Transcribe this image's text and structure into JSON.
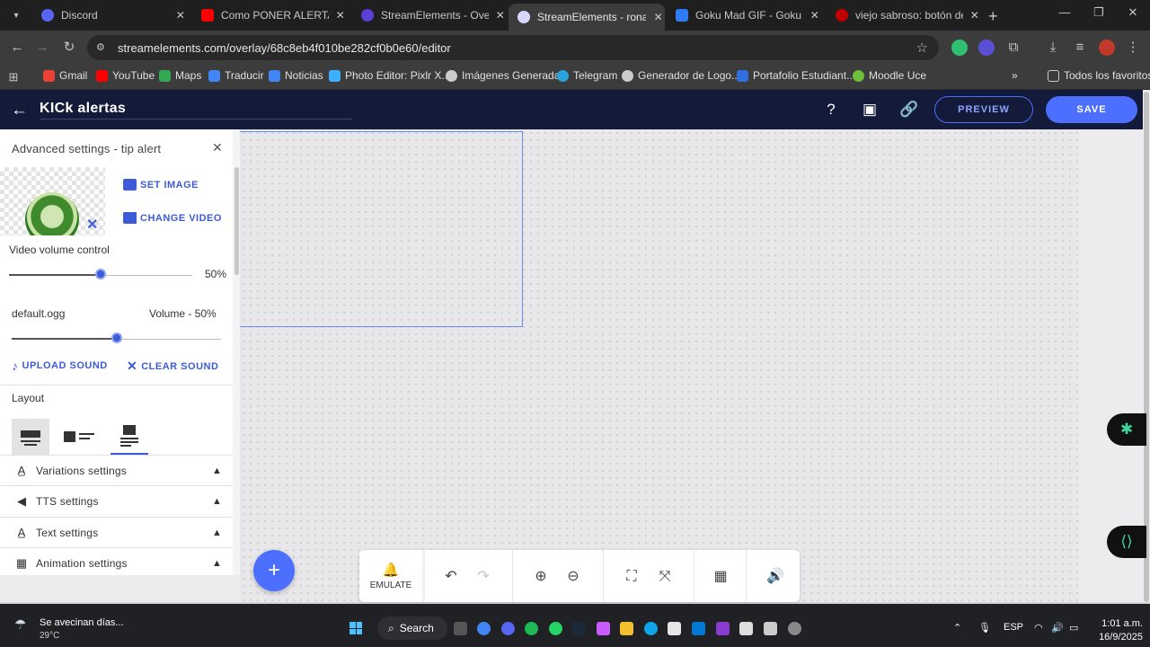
{
  "browser": {
    "tabs": [
      {
        "title": "Discord",
        "color": "#5865f2"
      },
      {
        "title": "Como PONER ALERTAS de",
        "color": "#ff0000"
      },
      {
        "title": "StreamElements - Overlays",
        "color": "#5b3fd6"
      },
      {
        "title": "StreamElements - ronaldr",
        "color": "#d8d8ff",
        "active": true
      },
      {
        "title": "Goku Mad GIF - Goku Mad",
        "color": "#2f7cf6"
      },
      {
        "title": "viejo sabroso: botón de e",
        "color": "#c00000"
      }
    ],
    "url": "streamelements.com/overlay/68c8eb4f010be282cf0b0e60/editor",
    "bookmarks": [
      {
        "label": "Gmail",
        "color": "#ea4335"
      },
      {
        "label": "YouTube",
        "color": "#ff0000"
      },
      {
        "label": "Maps",
        "color": "#34a853"
      },
      {
        "label": "Traducir",
        "color": "#4285f4"
      },
      {
        "label": "Noticias",
        "color": "#4285f4"
      },
      {
        "label": "Photo Editor: Pixlr X...",
        "color": "#3ab0ff"
      },
      {
        "label": "Imágenes Generadas",
        "color": "#cccccc"
      },
      {
        "label": "Telegram",
        "color": "#2aa3df"
      },
      {
        "label": "Generador de Logo...",
        "color": "#cccccc"
      },
      {
        "label": "Portafolio Estudiant...",
        "color": "#2f6fe0"
      },
      {
        "label": "Moodle Uce",
        "color": "#6cbf3a"
      }
    ],
    "all_bookmarks": "Todos los favoritos"
  },
  "header": {
    "overlay_name": "KICk alertas",
    "preview_label": "PREVIEW",
    "save_label": "SAVE",
    "accent": "#4d6fff",
    "bg": "#141a3a"
  },
  "panel": {
    "title": "Advanced settings - tip alert",
    "set_image": "SET IMAGE",
    "change_video": "CHANGE VIDEO",
    "video_volume_label": "Video volume control",
    "video_volume_value": "50%",
    "video_volume_level": 0.5,
    "sound_file": "default.ogg",
    "sound_volume": "Volume - 50%",
    "sound_volume_level": 0.5,
    "upload_sound": "UPLOAD SOUND",
    "clear_sound": "CLEAR SOUND",
    "layout_label": "Layout",
    "accordions": [
      {
        "label": "Variations settings",
        "icon": "text-icon"
      },
      {
        "label": "TTS settings",
        "icon": "speaker-icon"
      },
      {
        "label": "Text settings",
        "icon": "text-icon"
      },
      {
        "label": "Animation settings",
        "icon": "film-icon"
      }
    ]
  },
  "toolbar": {
    "emulate": "EMULATE"
  },
  "taskbar": {
    "weather_title": "Se avecinan días...",
    "weather_temp": "29°C",
    "search": "Search",
    "lang": "ESP",
    "time": "1:01 a.m.",
    "date": "16/9/2025"
  }
}
